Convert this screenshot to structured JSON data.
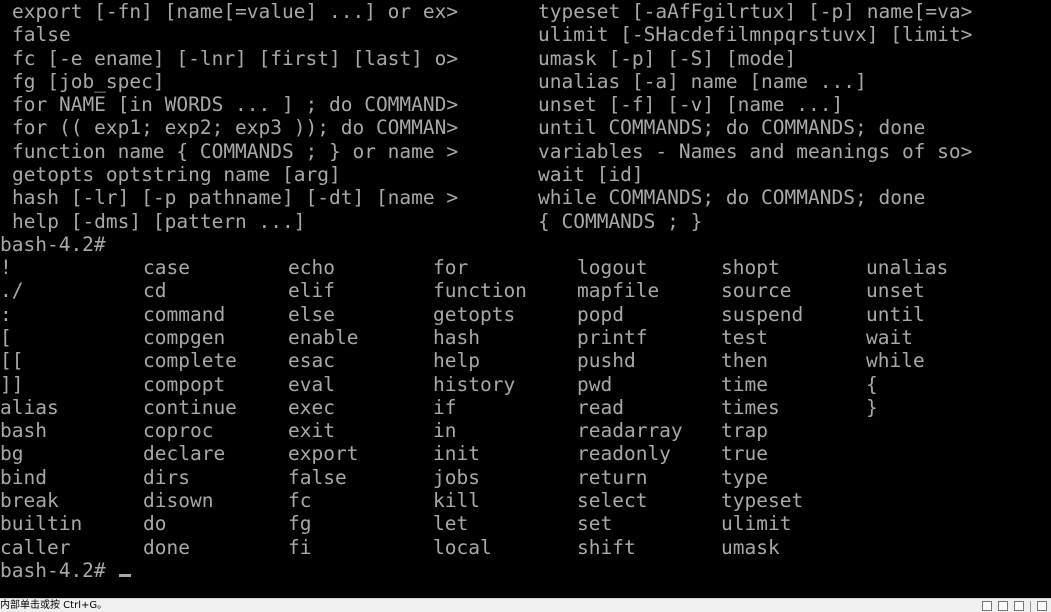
{
  "terminal": {
    "help_left": [
      "export [-fn] [name[=value] ...] or ex>",
      "false",
      "fc [-e ename] [-lnr] [first] [last] o>",
      "fg [job_spec]",
      "for NAME [in WORDS ... ] ; do COMMAND>",
      "for (( exp1; exp2; exp3 )); do COMMAN>",
      "function name { COMMANDS ; } or name >",
      "getopts optstring name [arg]",
      "hash [-lr] [-p pathname] [-dt] [name >",
      "help [-dms] [pattern ...]"
    ],
    "help_right": [
      "typeset [-aAfFgilrtux] [-p] name[=va>",
      "ulimit [-SHacdefilmnpqrstuvx] [limit>",
      "umask [-p] [-S] [mode]",
      "unalias [-a] name [name ...]",
      "unset [-f] [-v] [name ...]",
      "until COMMANDS; do COMMANDS; done",
      "variables - Names and meanings of so>",
      "wait [id]",
      "while COMMANDS; do COMMANDS; done",
      "{ COMMANDS ; }"
    ],
    "prompt_1": "bash-4.2#",
    "completion_columns": [
      [
        "!",
        "./",
        ":",
        "[",
        "[[",
        "]]",
        "alias",
        "bash",
        "bg",
        "bind",
        "break",
        "builtin",
        "caller"
      ],
      [
        "case",
        "cd",
        "command",
        "compgen",
        "complete",
        "compopt",
        "continue",
        "coproc",
        "declare",
        "dirs",
        "disown",
        "do",
        "done"
      ],
      [
        "echo",
        "elif",
        "else",
        "enable",
        "esac",
        "eval",
        "exec",
        "exit",
        "export",
        "false",
        "fc",
        "fg",
        "fi"
      ],
      [
        "for",
        "function",
        "getopts",
        "hash",
        "help",
        "history",
        "if",
        "in",
        "init",
        "jobs",
        "kill",
        "let",
        "local"
      ],
      [
        "logout",
        "mapfile",
        "popd",
        "printf",
        "pushd",
        "pwd",
        "read",
        "readarray",
        "readonly",
        "return",
        "select",
        "set",
        "shift"
      ],
      [
        "shopt",
        "source",
        "suspend",
        "test",
        "then",
        "time",
        "times",
        "trap",
        "true",
        "type",
        "typeset",
        "ulimit",
        "umask"
      ],
      [
        "unalias",
        "unset",
        "until",
        "wait",
        "while",
        "{",
        "}"
      ]
    ],
    "prompt_2": "bash-4.2#",
    "text_color": "#a8a8a8",
    "background": "#000000"
  },
  "statusbar": {
    "hint": "内部单击或按 Ctrl+G。"
  }
}
